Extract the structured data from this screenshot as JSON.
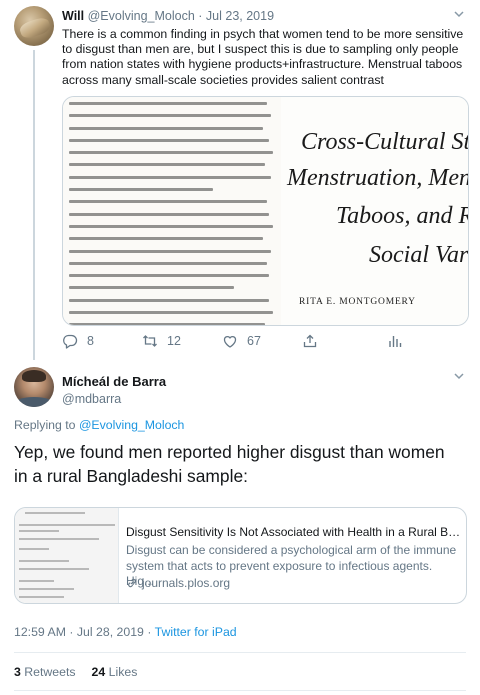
{
  "parent": {
    "name": "Will",
    "handle": "@Evolving_Moloch",
    "separator": "·",
    "date": "Jul 23, 2019",
    "text": "There is a common finding in psych that women tend to be more sensitive to disgust than men are, but I suspect this is due to sampling only people from nation states with hygiene products+infrastructure. Menstrual taboos across many small-scale societies provides salient contrast",
    "image": {
      "title_lines": [
        "Cross-Cultural Stud",
        "Menstruation, Menst",
        "Taboos, and Rel",
        "Social Varia"
      ],
      "author": "RITA E. MONTGOMERY"
    },
    "actions": {
      "replies": "8",
      "retweets": "12",
      "likes": "67"
    }
  },
  "reply": {
    "name": "Mícheál de Barra",
    "handle": "@mdbarra",
    "replying_prefix": "Replying to",
    "replying_to": "@Evolving_Moloch",
    "text": "Yep, we found men reported higher disgust than women in a rural Bangladeshi sample:",
    "card": {
      "title": "Disgust Sensitivity Is Not Associated with Health in a Rural Ba...",
      "description": "Disgust can be considered a psychological arm of the immune system that acts to prevent exposure to infectious agents. Hig...",
      "domain": "journals.plos.org"
    },
    "time": "12:59 AM · Jul 28, 2019",
    "separator": "·",
    "source": "Twitter for iPad",
    "retweets_count": "3",
    "retweets_label": "Retweets",
    "likes_count": "24",
    "likes_label": "Likes"
  },
  "colors": {
    "link": "#1b95e0",
    "muted": "#657786",
    "border": "#ccd6dd"
  }
}
